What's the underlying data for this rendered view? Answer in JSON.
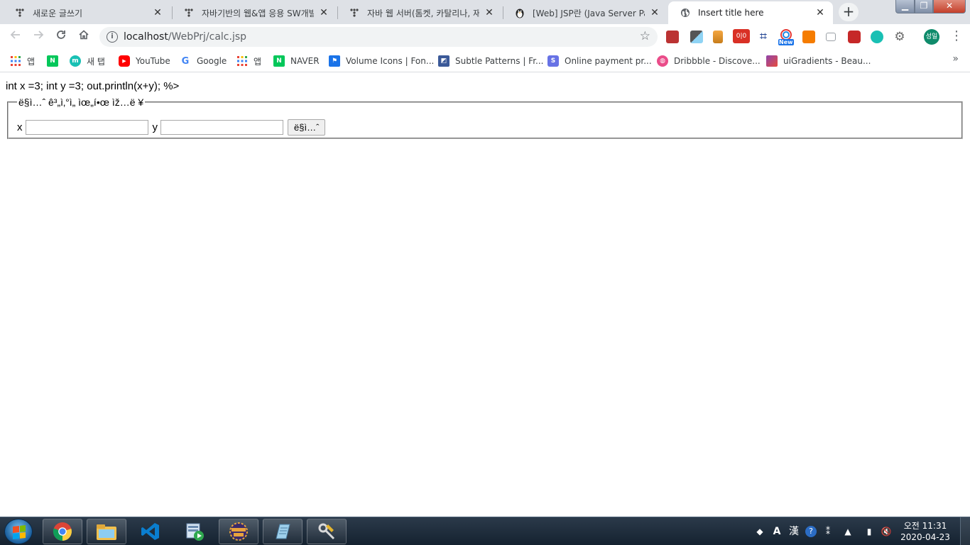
{
  "browser": {
    "tabs": [
      {
        "title": "새로운 글쓰기",
        "icon": "tistory-icon"
      },
      {
        "title": "자바기반의 웹&앱 응용 SW개발",
        "icon": "tistory-icon"
      },
      {
        "title": "자바 웹 서버(톰켓, 카탈리나, 재",
        "icon": "tistory-icon"
      },
      {
        "title": "[Web] JSP란 (Java Server Pages",
        "icon": "penguin-icon"
      },
      {
        "title": "Insert title here",
        "icon": "globe-icon",
        "active": true
      }
    ],
    "close_glyph": "✕",
    "new_tab_glyph": "+",
    "window_controls": {
      "minimize": "▁",
      "maximize": "❐",
      "close": "✕"
    },
    "address": {
      "host": "localhost",
      "path": "/WebPrj/calc.jsp"
    },
    "profile_initials": "성일",
    "extensions_badge": "New",
    "bookmarks": [
      {
        "label": "앱",
        "icon": "apps-grid-icon",
        "color": "#4285f4"
      },
      {
        "label": "",
        "icon": "naver-icon",
        "color": "#03c75a",
        "glyph": "N"
      },
      {
        "label": "새 탭",
        "icon": "m-icon",
        "color": "#19c0b4",
        "glyph": "m"
      },
      {
        "label": "YouTube",
        "icon": "youtube-icon",
        "color": "#ff0000",
        "glyph": "▶"
      },
      {
        "label": "Google",
        "icon": "google-icon",
        "color": "#4285f4",
        "glyph": "G"
      },
      {
        "label": "앱",
        "icon": "apps-grid-icon",
        "color": "#4285f4"
      },
      {
        "label": "NAVER",
        "icon": "naver-icon",
        "color": "#03c75a",
        "glyph": "N"
      },
      {
        "label": "Volume Icons | Fon...",
        "icon": "flag-icon",
        "color": "#1a73e8",
        "glyph": "⚑"
      },
      {
        "label": "Subtle Patterns | Fr...",
        "icon": "subtle-patterns-icon",
        "color": "#3b5998",
        "glyph": "◩"
      },
      {
        "label": "Online payment pr...",
        "icon": "stripe-icon",
        "color": "#6772e5",
        "glyph": "S"
      },
      {
        "label": "Dribbble - Discove...",
        "icon": "dribbble-icon",
        "color": "#ea4c89",
        "glyph": "◍"
      },
      {
        "label": "uiGradients - Beau...",
        "icon": "uigradients-icon",
        "color": "#8e44ad",
        "glyph": ""
      }
    ],
    "bookmarks_more": "»"
  },
  "page": {
    "code_line": "int x =3; int y =3; out.println(x+y); %>",
    "legend": "ë§ì…ˆ ê³„ì‚°ì„ ìœ„í•œ ìž…ë ¥",
    "x_label": "x",
    "y_label": "y",
    "x_value": "",
    "y_value": "",
    "submit_label": "ë§ì…ˆ"
  },
  "taskbar": {
    "apps": [
      "chrome-icon",
      "file-explorer-icon",
      "vscode-icon",
      "media-player-icon",
      "eclipse-javaee-icon",
      "notepad-icon",
      "tools-icon"
    ],
    "ime": {
      "mode": "A",
      "hanja": "漢"
    },
    "clock": {
      "time": "오전 11:31",
      "date": "2020-04-23"
    }
  },
  "colors": {
    "tab_strip": "#dee1e6",
    "active_tab": "#ffffff",
    "taskbar": "#1c2b3a",
    "avatar": "#0f8b6b"
  }
}
